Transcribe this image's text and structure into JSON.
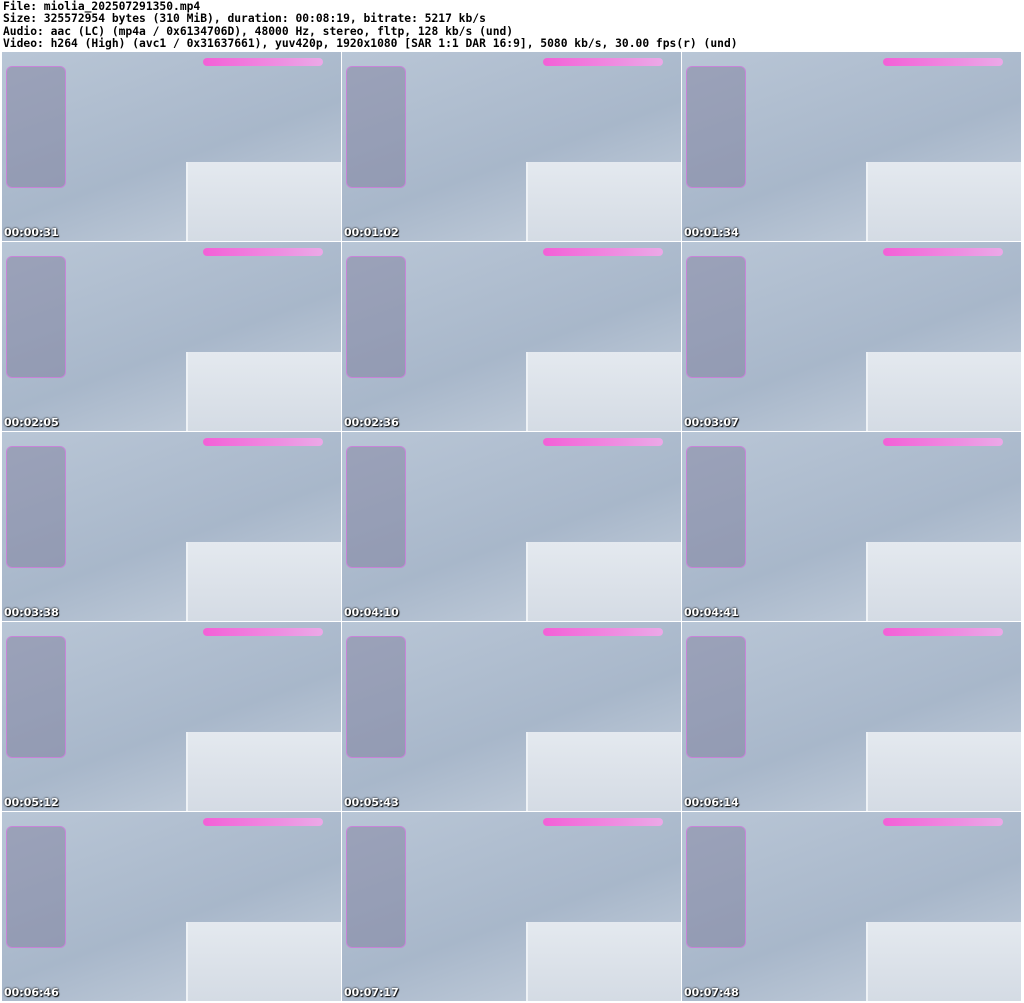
{
  "header": {
    "file": "File: miolia_202507291350.mp4",
    "size": "Size: 325572954 bytes (310 MiB), duration: 00:08:19, bitrate: 5217 kb/s",
    "audio": "Audio: aac (LC) (mp4a / 0x6134706D), 48000 Hz, stereo, fltp, 128 kb/s (und)",
    "video": "Video: h264 (High) (avc1 / 0x31637661), yuv420p, 1920x1080 [SAR 1:1 DAR 16:9], 5080 kb/s, 30.00 fps(r) (und)"
  },
  "thumbnails": [
    {
      "timestamp": "00:00:31"
    },
    {
      "timestamp": "00:01:02"
    },
    {
      "timestamp": "00:01:34"
    },
    {
      "timestamp": "00:02:05"
    },
    {
      "timestamp": "00:02:36"
    },
    {
      "timestamp": "00:03:07"
    },
    {
      "timestamp": "00:03:38"
    },
    {
      "timestamp": "00:04:10"
    },
    {
      "timestamp": "00:04:41"
    },
    {
      "timestamp": "00:05:12"
    },
    {
      "timestamp": "00:05:43"
    },
    {
      "timestamp": "00:06:14"
    },
    {
      "timestamp": "00:06:46"
    },
    {
      "timestamp": "00:07:17"
    },
    {
      "timestamp": "00:07:48"
    }
  ]
}
